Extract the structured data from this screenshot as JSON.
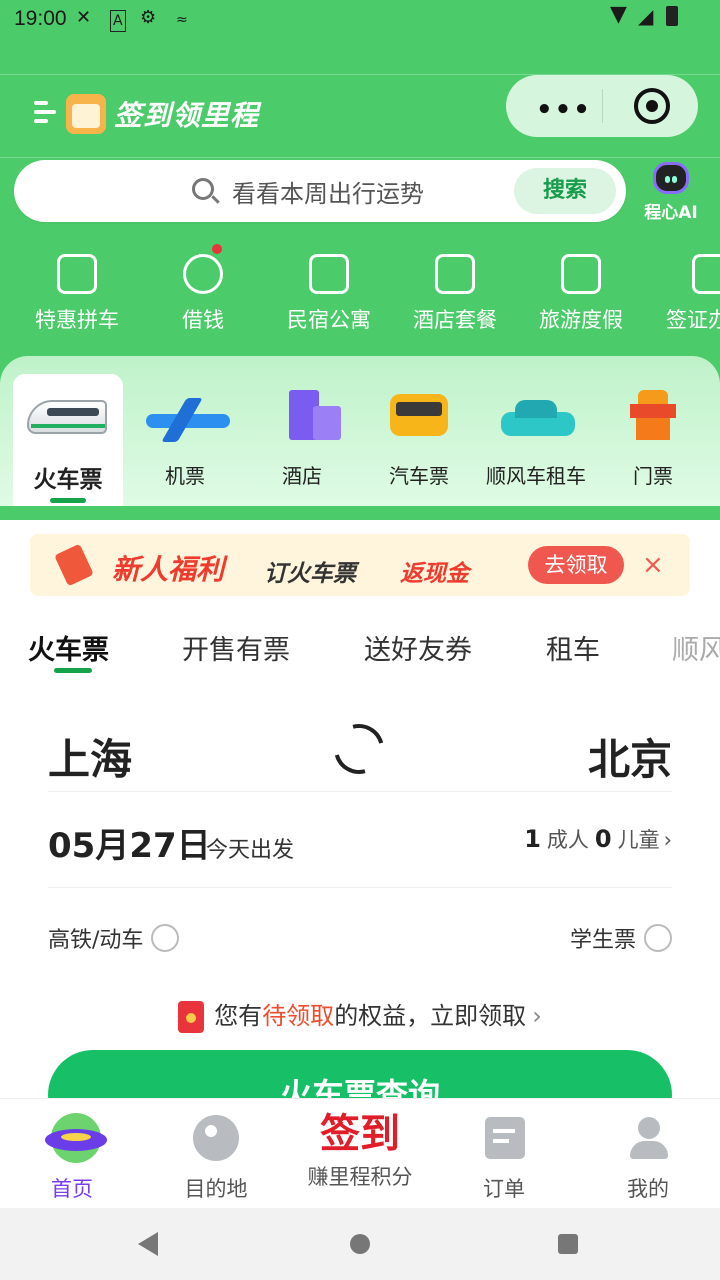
{
  "status_bar": {
    "time": "19:00"
  },
  "header": {
    "title": "签到领里程"
  },
  "search": {
    "placeholder": "看看本周出行运势",
    "button": "搜索"
  },
  "ai": {
    "label": "程心AI"
  },
  "quick_nav": [
    {
      "label": "特惠拼车",
      "icon": "car-share-icon"
    },
    {
      "label": "借钱",
      "icon": "money-bag-icon"
    },
    {
      "label": "民宿公寓",
      "icon": "house-icon"
    },
    {
      "label": "酒店套餐",
      "icon": "building-icon"
    },
    {
      "label": "旅游度假",
      "icon": "mountain-icon"
    },
    {
      "label": "签证办",
      "icon": "passport-icon"
    }
  ],
  "categories": [
    {
      "label": "火车票",
      "icon": "train-icon"
    },
    {
      "label": "机票",
      "icon": "plane-icon"
    },
    {
      "label": "酒店",
      "icon": "hotel-icon"
    },
    {
      "label": "汽车票",
      "icon": "bus-icon"
    },
    {
      "label": "顺风车租车",
      "icon": "car-icon"
    },
    {
      "label": "门票",
      "icon": "temple-icon"
    }
  ],
  "banner": {
    "title": "新人福利",
    "subtitle": "订火车票",
    "highlight": "返现金",
    "button": "去领取",
    "close": "×"
  },
  "tabs": [
    "火车票",
    "开售有票",
    "送好友券",
    "租车",
    "顺风车"
  ],
  "route": {
    "from": "上海",
    "to": "北京"
  },
  "date_row": {
    "date": "05月27日",
    "note": "今天出发",
    "adults": "1",
    "adult_label": "成人",
    "children": "0",
    "child_label": "儿童",
    "chevron": "›"
  },
  "options": {
    "high_speed": "高铁/动车",
    "student": "学生票"
  },
  "benefit": {
    "prefix": "您有",
    "highlight": "待领取",
    "suffix": "的权益，立即领取",
    "chevron": "›"
  },
  "query_button": "火车票查询",
  "bottom_nav": [
    {
      "label": "首页",
      "icon": "home-blimp-icon"
    },
    {
      "label": "目的地",
      "icon": "globe-icon"
    },
    {
      "label": "赚里程积分",
      "icon": "checkin-text",
      "text": "签到"
    },
    {
      "label": "订单",
      "icon": "order-icon"
    },
    {
      "label": "我的",
      "icon": "profile-icon"
    }
  ],
  "colors": {
    "primary_green": "#4ccb6a",
    "accent_green": "#17c066",
    "active_purple": "#7b3cf0",
    "alert_red": "#f04b2d"
  }
}
